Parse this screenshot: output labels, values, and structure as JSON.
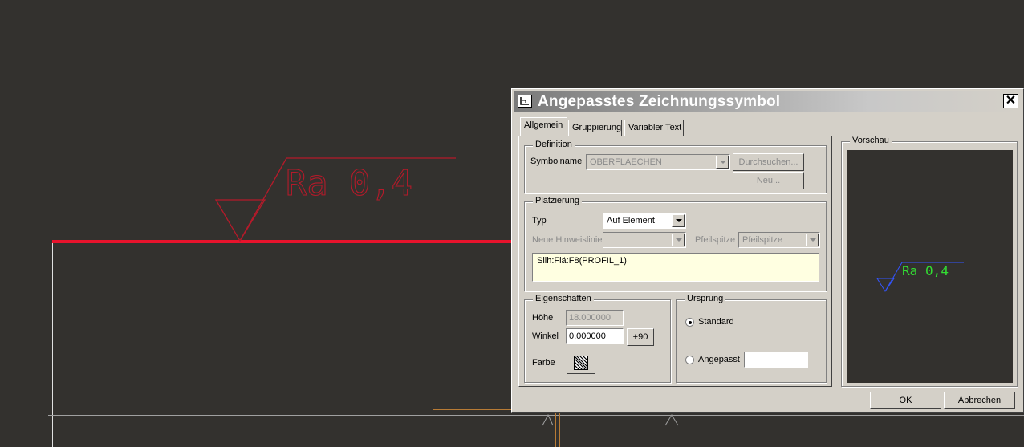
{
  "drawing": {
    "symbol_text": "Ra 0,4",
    "colors": {
      "background": "#33312e",
      "selected_edge": "#e8132c",
      "symbol": "#b51a2a",
      "aux_lines": "#b87b35",
      "white_lines": "#e0e0e0"
    }
  },
  "dialog": {
    "title": "Angepasstes Zeichnungssymbol",
    "close_label": "✕",
    "tabs": [
      "Allgemein",
      "Gruppierung",
      "Variabler Text"
    ],
    "active_tab": "Allgemein",
    "definition": {
      "group_label": "Definition",
      "symbolname_label": "Symbolname",
      "symbolname_value": "OBERFLAECHEN",
      "browse_label": "Durchsuchen...",
      "new_label": "Neu..."
    },
    "placement": {
      "group_label": "Platzierung",
      "typ_label": "Typ",
      "typ_value": "Auf Element",
      "leader_label": "Neue Hinweislinie",
      "leader_value": "",
      "arrow_label": "Pfeilspitze",
      "arrow_value": "Pfeilspitze",
      "reference": "Silh:Flä:F8(PROFIL_1)"
    },
    "properties": {
      "group_label": "Eigenschaften",
      "height_label": "Höhe",
      "height_value": "18.000000",
      "angle_label": "Winkel",
      "angle_value": "0.000000",
      "plus90_label": "+90",
      "color_label": "Farbe"
    },
    "origin": {
      "group_label": "Ursprung",
      "standard_label": "Standard",
      "custom_label": "Angepasst",
      "custom_value": "",
      "selected": "Standard"
    },
    "preview": {
      "group_label": "Vorschau",
      "symbol_text": "Ra 0,4",
      "colors": {
        "text": "#33dd33",
        "line": "#3355ff"
      }
    },
    "ok_label": "OK",
    "cancel_label": "Abbrechen"
  }
}
